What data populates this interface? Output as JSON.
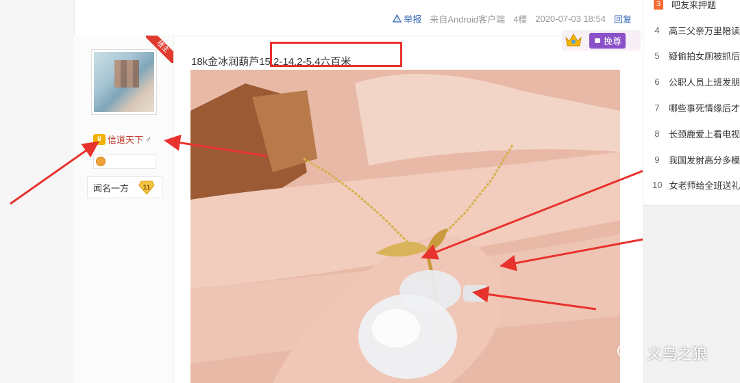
{
  "post_footer": {
    "report_label": "举报",
    "source_text": "来自Android客户端",
    "floor": "4楼",
    "datetime": "2020-07-03 18:54",
    "reply_label": "回复"
  },
  "author": {
    "corner_tag": "楼主",
    "username": "信道天下",
    "gender_symbol": "♂",
    "forum_level_name": "闻名一方",
    "level_number": "11"
  },
  "member_badge": {
    "label": "挽尊"
  },
  "post": {
    "title": "18k金冰润葫芦15.2-14.2-5.4六百米"
  },
  "hotlist": {
    "items": [
      {
        "rank": "3",
        "text": "吧友来押题",
        "top": true
      },
      {
        "rank": "4",
        "text": "高三父亲万里陪读",
        "top": false
      },
      {
        "rank": "5",
        "text": "疑偷拍女厕被抓后",
        "top": false
      },
      {
        "rank": "6",
        "text": "公职人员上班发朋",
        "top": false
      },
      {
        "rank": "7",
        "text": "哪些事死情缘后才",
        "top": false
      },
      {
        "rank": "8",
        "text": "长颈鹿爱上看电视",
        "top": false
      },
      {
        "rank": "9",
        "text": "我国发射高分多模",
        "top": false
      },
      {
        "rank": "10",
        "text": "女老师给全班送礼",
        "top": false
      }
    ]
  },
  "watermark": {
    "text": "义乌之狼",
    "icon": "wechat-icon"
  },
  "colors": {
    "link_blue": "#2d64b3",
    "annotation_red": "#e8322d",
    "username_red": "#c0392b",
    "hot_orange": "#f56a33",
    "member_purple": "#8a50c7"
  }
}
